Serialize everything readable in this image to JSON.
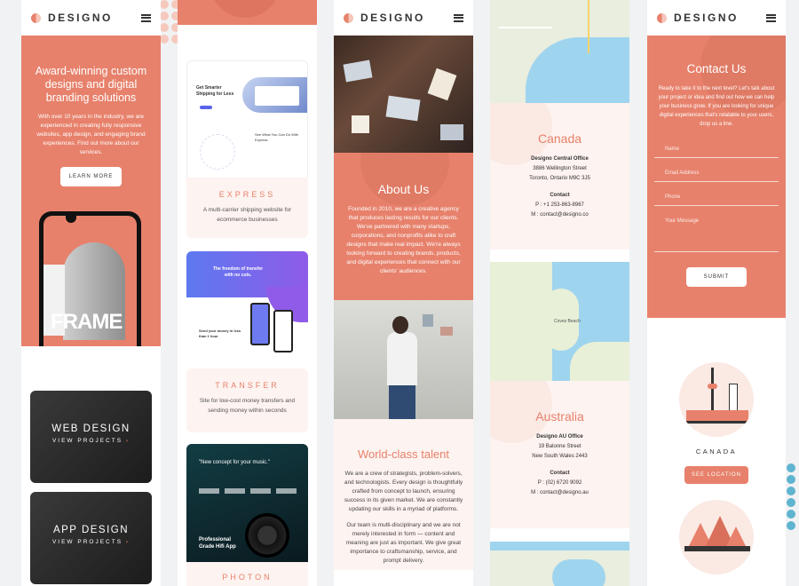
{
  "brand": {
    "name": "DESIGNO"
  },
  "colors": {
    "accent": "#e7816b",
    "accent_light": "#fdf3f0",
    "dark": "#333136"
  },
  "col1": {
    "hero_title": "Award-winning custom designs and digital branding solutions",
    "hero_text": "With over 10 years in the industry, we are experienced in creating fully responsive websites, app design, and engaging brand experiences. Find out more about our services.",
    "learn_more": "LEARN MORE",
    "phone_brand": "FRAME",
    "cards": [
      {
        "title": "WEB DESIGN",
        "link": "VIEW PROJECTS"
      },
      {
        "title": "APP DESIGN",
        "link": "VIEW PROJECTS"
      }
    ]
  },
  "col2": {
    "projects": [
      {
        "title": "EXPRESS",
        "desc": "A multi-carrier shipping website for ecommerce businesses",
        "shot_headline": "Get Smarter Shipping for Less",
        "shot_sub": "See What You Can Do With Express"
      },
      {
        "title": "TRANSFER",
        "desc": "Site for low-cost money transfers and sending money within seconds",
        "shot_headline": "The freedom of transfer with no cuts.",
        "shot_sub": "Send your money in less than 1 hour"
      },
      {
        "title": "PHOTON",
        "shot_headline": "\"New concept for your music.\"",
        "shot_sub": "Professional Grade Hifi App"
      }
    ]
  },
  "col3": {
    "about_title": "About Us",
    "about_text": "Founded in 2010, we are a creative agency that produces lasting results for our clients. We've partnered with many startups, corporations, and nonprofits alike to craft designs that make real impact. We're always looking forward to creating brands, products, and digital experiences that connect with our clients' audiences.",
    "talent_title": "World-class talent",
    "talent_text1": "We are a crew of strategists, problem-solvers, and technologists. Every design is thoughtfully crafted from concept to launch, ensuring success in its given market. We are constantly updating our skills in a myriad of platforms.",
    "talent_text2": "Our team is multi-disciplinary and we are not merely interested in form — content and meaning are just as important. We give great importance to craftsmanship, service, and prompt delivery."
  },
  "col4": {
    "canada": {
      "country": "Canada",
      "office": "Designo Central Office",
      "line1": "3886 Wellington Street",
      "line2": "Toronto, Ontario M9C 3J5",
      "contact": "Contact",
      "phone": "P : +1 253-863-8967",
      "mail": "M : contact@designo.co"
    },
    "australia": {
      "country": "Australia",
      "office": "Designo AU Office",
      "line1": "19 Balonne Street",
      "line2": "New South Wales 2443",
      "contact": "Contact",
      "phone": "P : (02) 6720 9092",
      "mail": "M : contact@designo.au"
    },
    "map_label": "Coves Beach"
  },
  "col5": {
    "contact_title": "Contact Us",
    "contact_text": "Ready to take it to the next level? Let's talk about your project or idea and find out how we can help your business grow. If you are looking for unique digital experiences that's relatable to your users, drop us a line.",
    "fields": [
      "Name",
      "Email Address",
      "Phone",
      "Your Message"
    ],
    "submit": "SUBMIT",
    "location_label": "CANADA",
    "location_button": "SEE LOCATION"
  }
}
